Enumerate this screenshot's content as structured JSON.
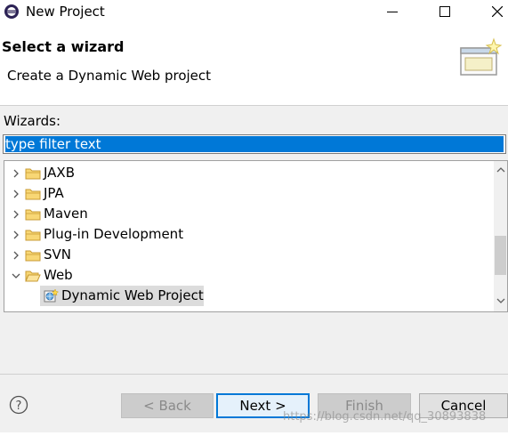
{
  "window": {
    "title": "New Project",
    "icon": "eclipse-icon",
    "controls": [
      "minimize-icon",
      "maximize-icon",
      "close-icon"
    ]
  },
  "banner": {
    "title": "Select a wizard",
    "description": "Create a Dynamic Web project",
    "icon": "wizard-banner-icon"
  },
  "wizards": {
    "label": "Wizards:",
    "filter_placeholder": "type filter text",
    "tree": [
      {
        "label": "JAXB",
        "expanded": false,
        "type": "folder"
      },
      {
        "label": "JPA",
        "expanded": false,
        "type": "folder"
      },
      {
        "label": "Maven",
        "expanded": false,
        "type": "folder"
      },
      {
        "label": "Plug-in Development",
        "expanded": false,
        "type": "folder"
      },
      {
        "label": "SVN",
        "expanded": false,
        "type": "folder"
      },
      {
        "label": "Web",
        "expanded": true,
        "type": "folder"
      },
      {
        "label": "Dynamic Web Project",
        "type": "wizard",
        "selected": true
      }
    ]
  },
  "buttons": {
    "back": "< Back",
    "next": "Next >",
    "finish": "Finish",
    "cancel": "Cancel"
  },
  "watermark": "https://blog.csdn.net/qq_30893838",
  "colors": {
    "selection": "#0078d7",
    "folder": "#dcb35c",
    "default_button_border": "#0078d7"
  }
}
